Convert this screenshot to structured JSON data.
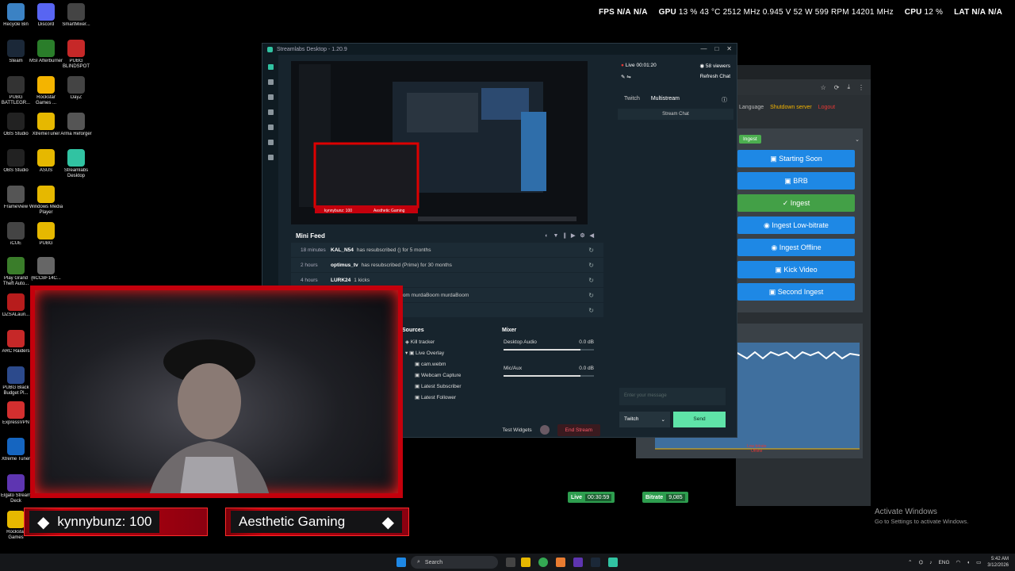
{
  "desktop_icons": [
    {
      "label": "Recycle Bin",
      "icon": "recycle-bin-icon",
      "color": "#3b82c4"
    },
    {
      "label": "Discord",
      "icon": "discord-icon",
      "color": "#5865f2"
    },
    {
      "label": "SmartMixer...",
      "icon": "smartmixer-icon",
      "color": "#444"
    },
    {
      "label": "Steam",
      "icon": "steam-icon",
      "color": "#1b2838"
    },
    {
      "label": "MSI Afterburner",
      "icon": "msi-afterburner-icon",
      "color": "#2a7d2a"
    },
    {
      "label": "PUBG BLINDSPOT",
      "icon": "pubg-blindspot-icon",
      "color": "#c62828"
    },
    {
      "label": "PUBG BATTLEGR...",
      "icon": "pubg-icon",
      "color": "#333"
    },
    {
      "label": "Rockstar Games ...",
      "icon": "rockstar-icon",
      "color": "#f4b400"
    },
    {
      "label": "DayZ",
      "icon": "dayz-icon",
      "color": "#444"
    },
    {
      "label": "OBS Studio",
      "icon": "obs-icon",
      "color": "#222"
    },
    {
      "label": "XtremeTuner",
      "icon": "folder-icon",
      "color": "#e6b800"
    },
    {
      "label": "Arma Reforger",
      "icon": "arma-icon",
      "color": "#555"
    },
    {
      "label": "OBS Studio",
      "icon": "obs-icon",
      "color": "#222"
    },
    {
      "label": "ASUS",
      "icon": "folder-icon",
      "color": "#e6b800"
    },
    {
      "label": "Streamlabs Desktop",
      "icon": "streamlabs-icon",
      "color": "#31c3a2"
    },
    {
      "label": "FrameView",
      "icon": "frameview-icon",
      "color": "#555"
    },
    {
      "label": "Windows Media Player",
      "icon": "folder-icon",
      "color": "#e6b800"
    },
    {
      "label": "iCUE",
      "icon": "icue-icon",
      "color": "#444"
    },
    {
      "label": "PUBG",
      "icon": "folder-icon",
      "color": "#e6b800"
    },
    {
      "label": "Play Grand Theft Auto...",
      "icon": "gta-icon",
      "color": "#3a7d2a"
    },
    {
      "label": "{6CCBF14C...",
      "icon": "file-icon",
      "color": "#666"
    },
    {
      "label": "DZSALaun...",
      "icon": "dzsa-icon",
      "color": "#b71c1c"
    },
    {
      "label": "ARC Raiders",
      "icon": "arc-raiders-icon",
      "color": "#c62828"
    },
    {
      "label": "PUBG Black Budget Pl...",
      "icon": "pubg-black-icon",
      "color": "#2c4a8c"
    },
    {
      "label": "ExpressVPN",
      "icon": "expressvpn-icon",
      "color": "#d32f2f"
    },
    {
      "label": "Xtreme Tuner",
      "icon": "xtreme-tuner-icon",
      "color": "#1565c0"
    },
    {
      "label": "Elgato Stream Deck",
      "icon": "stream-deck-icon",
      "color": "#5e35b1"
    },
    {
      "label": "Rockstar Games",
      "icon": "folder-icon",
      "color": "#e6b800"
    }
  ],
  "osd": {
    "fps_label": "FPS",
    "fps_value": "N/A",
    "fps_value2": "N/A",
    "gpu_label": "GPU",
    "gpu_util": "13 %",
    "gpu_temp": "43 °C",
    "gpu_clock": "2512 MHz",
    "gpu_volt": "0.945 V",
    "gpu_power": "52 W",
    "gpu_fan": "599 RPM",
    "gpu_mem": "14201 MHz",
    "cpu_label": "CPU",
    "cpu_util": "12 %",
    "lat_label": "LAT",
    "lat_value": "N/A",
    "lat_value2": "N/A"
  },
  "streamlabs": {
    "title": "Streamlabs Desktop - 1.20.9",
    "mini_feed": {
      "title": "Mini Feed",
      "rows": [
        {
          "time": "18 minutes",
          "user": "KAL_N54",
          "text": "has resubscribed () for 5 months"
        },
        {
          "time": "2 hours",
          "user": "optimus_tv",
          "text": "has resubscribed (Prime) for 30 months"
        },
        {
          "time": "4 hours",
          "user": "LURK24",
          "text": "1 kicks"
        },
        {
          "time": "",
          "user": "",
          "text": "(Tier 1) for 3 months  murdaBoom murdaBoom murdaBoom"
        },
        {
          "time": "",
          "user": "TeckyOne",
          "text": ""
        }
      ]
    },
    "sources": {
      "title": "Sources",
      "items": [
        "Kill tracker",
        "Live Overlay",
        "cam.webm",
        "Webcam Capture",
        "Latest Subscriber",
        "Latest Follower"
      ]
    },
    "mixer": {
      "title": "Mixer",
      "channels": [
        {
          "name": "Desktop Audio",
          "level": "0.0 dB",
          "fill": 0.85
        },
        {
          "name": "Mic/Aux",
          "level": "0.0 dB",
          "fill": 0.85
        }
      ]
    },
    "test_widgets": "Test Widgets",
    "end_stream": "End Stream",
    "chat": {
      "live": "Live 00:01:20",
      "viewers": "58 viewers",
      "refresh": "Refresh Chat",
      "tab1": "Twitch",
      "tab2": "Multistream",
      "sub_tab": "Stream Chat",
      "input_placeholder": "Enter your message",
      "platform": "Twitch",
      "send": "Send"
    }
  },
  "web": {
    "language": "Language",
    "shutdown": "Shutdown server",
    "logout": "Logout",
    "ingest_badge": "Ingest",
    "buttons": [
      {
        "label": "Starting Soon",
        "active": false
      },
      {
        "label": "BRB",
        "active": false
      },
      {
        "label": "Ingest",
        "active": true
      },
      {
        "label": "Ingest Low-bitrate",
        "active": false
      },
      {
        "label": "Ingest Offline",
        "active": false
      },
      {
        "label": "Kick Video",
        "active": false
      },
      {
        "label": "Second Ingest",
        "active": false
      }
    ],
    "graph_label": "Low bitrate\nOffline"
  },
  "status": {
    "live_label": "Live",
    "live_time": "00:30:59",
    "bitrate_label": "Bitrate",
    "bitrate_value": "9,085"
  },
  "overlay": {
    "name_left": "kynnybunz: 100",
    "name_right": "Aesthetic Gaming"
  },
  "preview_overlay": {
    "name_left": "kynnybunz: 100",
    "name_right": "Aesthetic Gaming"
  },
  "watermark": {
    "line1": "Activate Windows",
    "line2": "Go to Settings to activate Windows."
  },
  "taskbar": {
    "search_placeholder": "Search",
    "lang": "ENG",
    "time": "5:42 AM",
    "date": "3/12/2026"
  },
  "colors": {
    "accent_streamlabs": "#31c3a2",
    "live_red": "#c4000c",
    "button_blue": "#1e88e5",
    "button_green": "#43a047"
  }
}
